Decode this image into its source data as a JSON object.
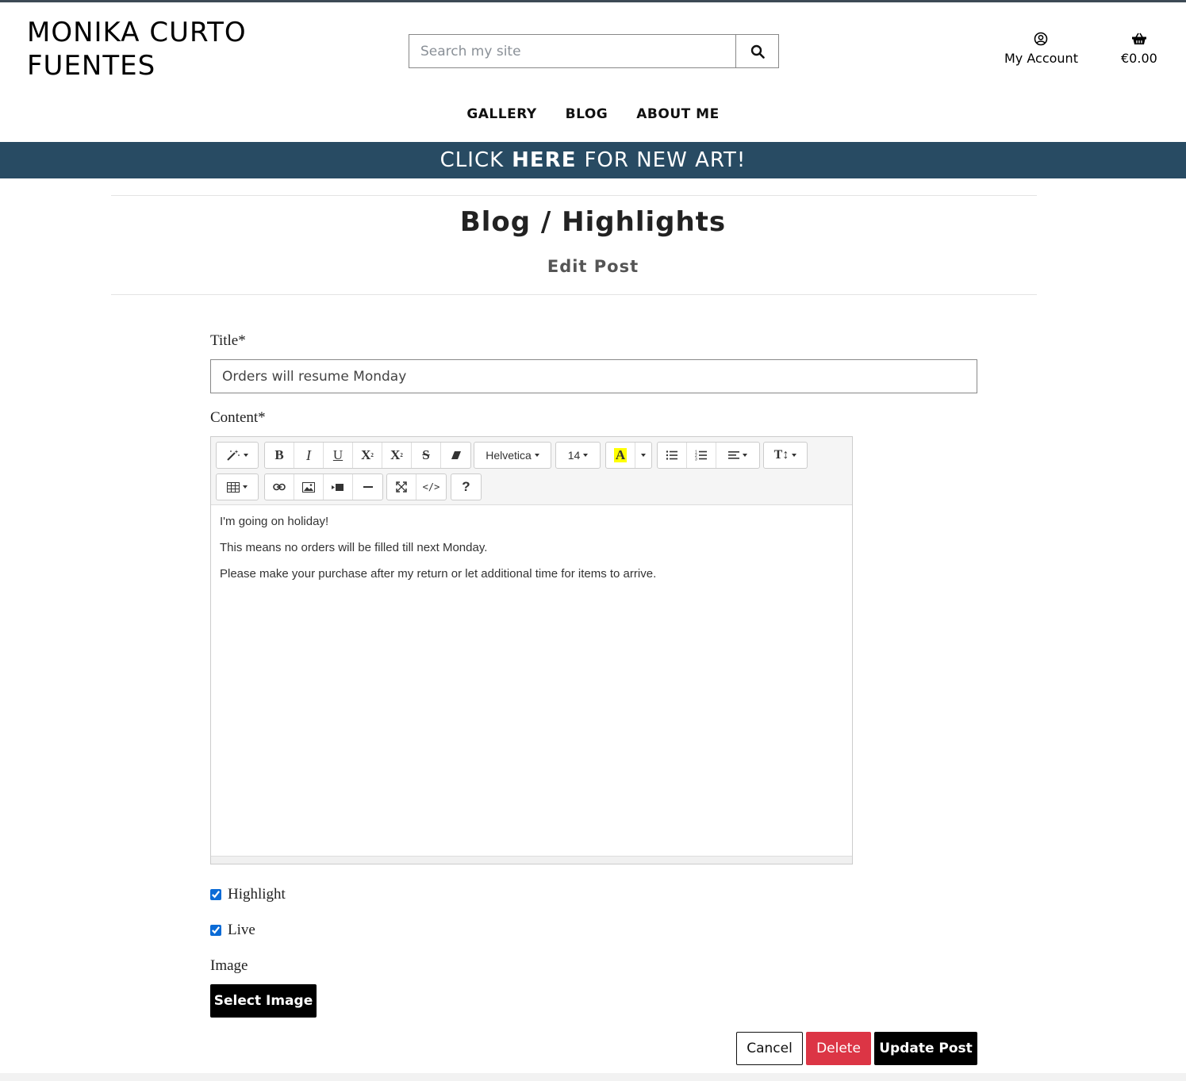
{
  "brand": {
    "line1": "MONIKA CURTO",
    "line2": "FUENTES"
  },
  "search": {
    "placeholder": "Search my site",
    "icon": "search-icon"
  },
  "account": {
    "label": "My Account",
    "icon": "user-circle-icon"
  },
  "cart": {
    "label": "€0.00",
    "icon": "basket-icon"
  },
  "nav": {
    "items": [
      "GALLERY",
      "BLOG",
      "ABOUT ME"
    ]
  },
  "banner": {
    "pre": "CLICK",
    "strong": "HERE",
    "post": "FOR NEW ART!"
  },
  "page": {
    "title": "Blog / Highlights",
    "subtitle": "Edit Post"
  },
  "form": {
    "title_label": "Title*",
    "title_value": "Orders will resume Monday",
    "content_label": "Content*",
    "editor": {
      "font_name": "Helvetica",
      "font_size": "14",
      "paragraphs": [
        "I'm going on holiday!",
        "This means no orders will be filled till next Monday.",
        "Please make your purchase after my return or let additional time for items to arrive."
      ]
    },
    "highlight_label": "Highlight",
    "highlight_checked": true,
    "live_label": "Live",
    "live_checked": true,
    "image_label": "Image",
    "select_image": "Select Image",
    "cancel": "Cancel",
    "delete": "Delete",
    "update": "Update Post"
  },
  "colors": {
    "banner": "#284b63",
    "delete": "#dc3545",
    "primary": "#000000"
  }
}
